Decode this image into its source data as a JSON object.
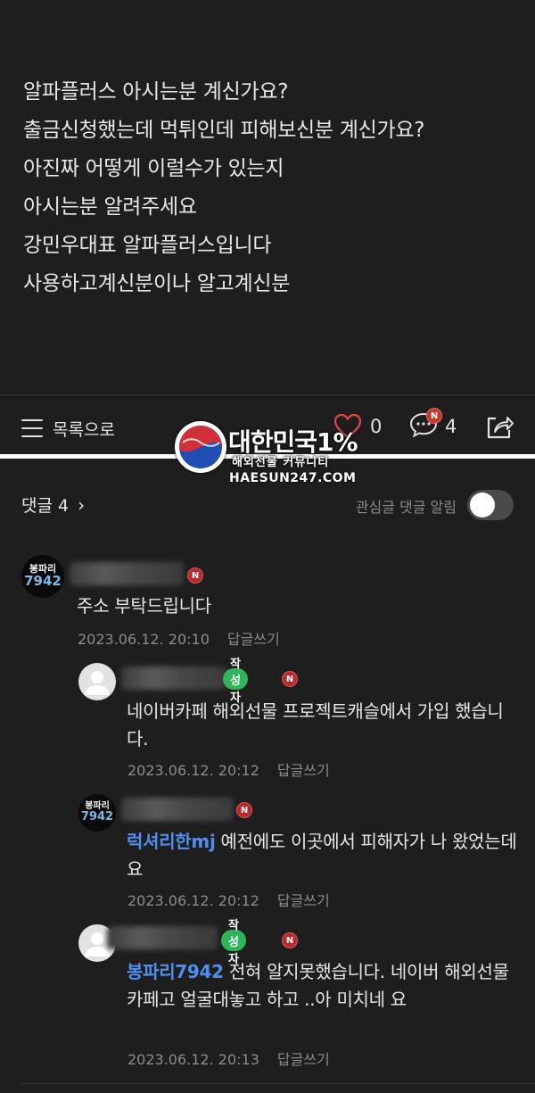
{
  "post": {
    "lines": [
      "알파플러스 아시는분 계신가요?",
      "출금신청했는데  먹튀인데 피해보신분 계신가요?",
      "아진짜 어떻게 이럴수가 있는지",
      "아시는분 알려주세요",
      "강민우대표 알파플러스입니다",
      "사용하고계신분이나 알고계신분"
    ]
  },
  "action_bar": {
    "list_label": "목록으로",
    "like_count": "0",
    "comment_count": "4",
    "new_badge": "N"
  },
  "watermark": {
    "title": "대한민국1%",
    "subtitle": "해외선물 커뮤니티",
    "url": "HAESUN247.COM"
  },
  "comments_header": {
    "title": "댓글 4",
    "notify_label": "관심글 댓글 알림",
    "notify_on": false
  },
  "comments": [
    {
      "avatar_top": "봉파리",
      "avatar_bottom": "7942",
      "new_badge": "N",
      "text": "주소 부탁드립니다",
      "date": "2023.06.12. 20:10",
      "reply_label": "답글쓰기"
    },
    {
      "author_badge": "작성자",
      "new_badge": "N",
      "text": "네이버카페 해외선물 프로젝트캐슬에서 가입 했습니다.",
      "date": "2023.06.12. 20:12",
      "reply_label": "답글쓰기"
    },
    {
      "avatar_top": "봉파리",
      "avatar_bottom": "7942",
      "new_badge": "N",
      "mention": "럭셔리한mj",
      "text": " 예전에도 이곳에서 피해자가 나 왔었는데요",
      "date": "2023.06.12. 20:12",
      "reply_label": "답글쓰기"
    },
    {
      "author_badge": "작성자",
      "new_badge": "N",
      "mention": "봉파리7942",
      "text": " 전혀 알지못했습니다. 네이버 해외선물카페고 얼굴대놓고 하고 ..아 미치네 요",
      "date": "2023.06.12. 20:13",
      "reply_label": "답글쓰기"
    }
  ],
  "colors": {
    "background": "#1e1e1e",
    "mention": "#4f8ff0",
    "author_badge": "#2fb45a",
    "new_badge": "#b52b2b"
  }
}
